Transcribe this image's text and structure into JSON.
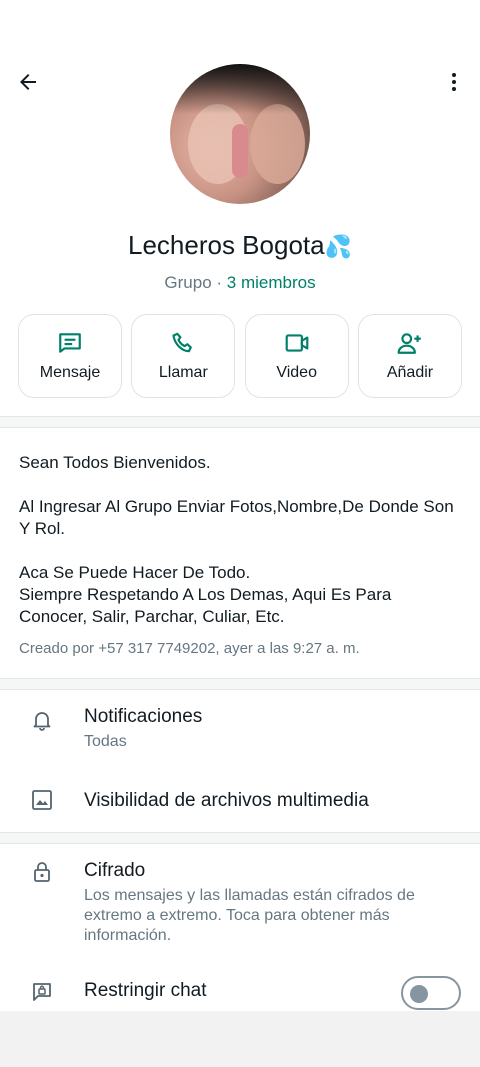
{
  "header": {
    "back_icon": "arrow-left-icon",
    "more_icon": "more-vertical-icon"
  },
  "group": {
    "name": "Lecheros Bogota",
    "emoji": "💦",
    "type_label": "Grupo",
    "separator": " · ",
    "members": "3 miembros"
  },
  "actions": [
    {
      "label": "Mensaje",
      "icon": "message-icon"
    },
    {
      "label": "Llamar",
      "icon": "phone-icon"
    },
    {
      "label": "Video",
      "icon": "video-icon"
    },
    {
      "label": "Añadir",
      "icon": "add-person-icon"
    }
  ],
  "description": {
    "line1": "Sean Todos Bienvenidos.",
    "line2": "Al Ingresar Al Grupo Enviar Fotos,Nombre,De Donde Son Y Rol.",
    "line3": "Aca Se Puede Hacer De Todo.",
    "line4": "Siempre Respetando A Los Demas, Aqui Es Para Conocer, Salir, Parchar, Culiar, Etc.",
    "created": "Creado por +57 317 7749202, ayer a las 9:27 a. m."
  },
  "settings": {
    "notifications": {
      "title": "Notificaciones",
      "value": "Todas",
      "icon": "bell-icon"
    },
    "media_visibility": {
      "title": "Visibilidad de archivos multimedia",
      "icon": "image-icon"
    },
    "encryption": {
      "title": "Cifrado",
      "description": "Los mensajes y las llamadas están cifrados de extremo a extremo. Toca para obtener más información.",
      "icon": "lock-icon"
    },
    "restrict_chat": {
      "title": "Restringir chat",
      "enabled": false,
      "icon": "restricted-chat-icon"
    }
  },
  "colors": {
    "accent": "#008069",
    "text_primary": "#111b21",
    "text_secondary": "#667781"
  }
}
